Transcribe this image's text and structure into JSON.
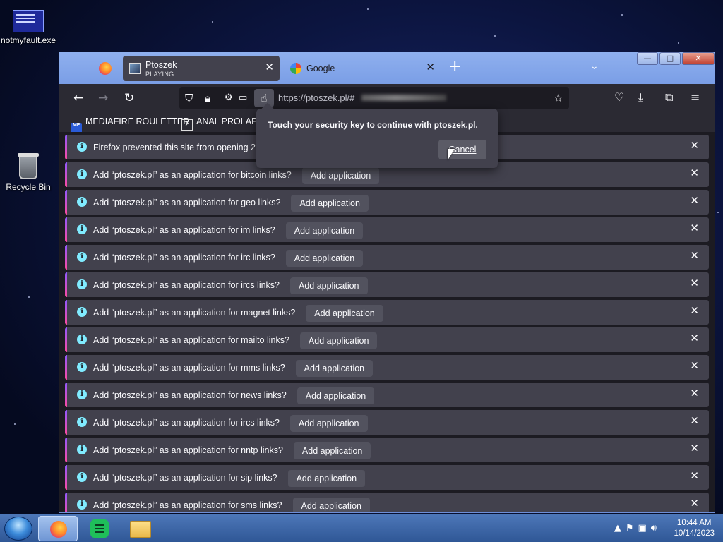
{
  "desktop": {
    "icons": [
      {
        "label": "notmyfault.exe"
      },
      {
        "label": "Recycle Bin"
      }
    ]
  },
  "browser": {
    "tabs": [
      {
        "title": "Ptoszek",
        "subtitle": "PLAYING",
        "active": true
      },
      {
        "title": "Google",
        "active": false
      }
    ],
    "address": {
      "url": "https://ptoszek.pl/#"
    },
    "bookmarks": [
      {
        "label": "MEDIAFIRE ROULETTER",
        "icon_text": "MF"
      },
      {
        "label": "ANAL PROLAPS"
      }
    ],
    "popup": {
      "message": "Touch your security key to continue with ptoszek.pl.",
      "cancel_label": "Cancel"
    },
    "notifications": [
      {
        "message": "Firefox prevented this site from opening 2 p",
        "action": ""
      },
      {
        "message": "Add “ptoszek.pl” as an application for bitcoin links?",
        "action": "Add application"
      },
      {
        "message": "Add “ptoszek.pl” as an application for geo links?",
        "action": "Add application"
      },
      {
        "message": "Add “ptoszek.pl” as an application for im links?",
        "action": "Add application"
      },
      {
        "message": "Add “ptoszek.pl” as an application for irc links?",
        "action": "Add application"
      },
      {
        "message": "Add “ptoszek.pl” as an application for ircs links?",
        "action": "Add application"
      },
      {
        "message": "Add “ptoszek.pl” as an application for magnet links?",
        "action": "Add application"
      },
      {
        "message": "Add “ptoszek.pl” as an application for mailto links?",
        "action": "Add application"
      },
      {
        "message": "Add “ptoszek.pl” as an application for mms links?",
        "action": "Add application"
      },
      {
        "message": "Add “ptoszek.pl” as an application for news links?",
        "action": "Add application"
      },
      {
        "message": "Add “ptoszek.pl” as an application for ircs links?",
        "action": "Add application"
      },
      {
        "message": "Add “ptoszek.pl” as an application for nntp links?",
        "action": "Add application"
      },
      {
        "message": "Add “ptoszek.pl” as an application for sip links?",
        "action": "Add application"
      },
      {
        "message": "Add “ptoszek.pl” as an application for sms links?",
        "action": "Add application"
      }
    ]
  },
  "taskbar": {
    "time": "10:44 AM",
    "date": "10/14/2023"
  },
  "colors": {
    "accent_gradient_start": "#9059ff",
    "accent_gradient_end": "#ff4aa2",
    "info_icon": "#80ebff",
    "bar_bg": "#42414d",
    "browser_bg": "#1c1b22"
  }
}
